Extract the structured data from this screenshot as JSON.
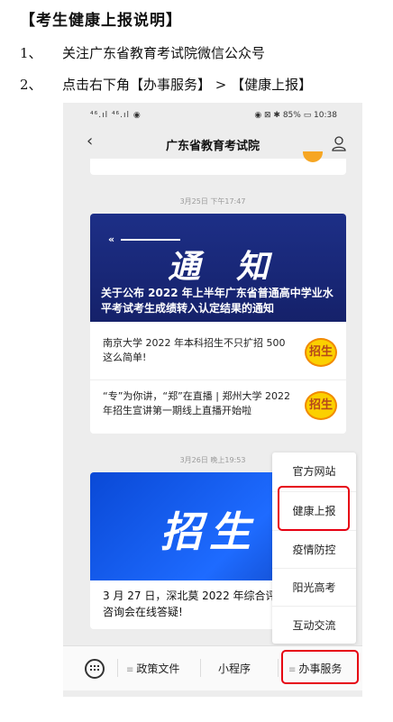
{
  "instructions": {
    "title": "【考生健康上报说明】",
    "steps": [
      {
        "num": "1、",
        "text": "关注广东省教育考试院微信公众号"
      },
      {
        "num": "2、",
        "text": "点击右下角【办事服务】 > 【健康上报】"
      }
    ]
  },
  "statusbar": {
    "left": "⁴⁶.ıl ⁴⁶.ıl ◉",
    "right": "◉ ⊠ ✱ 85% ▭ 10:38"
  },
  "nav": {
    "back_glyph": "‹",
    "title": "广东省教育考试院"
  },
  "feed": {
    "timestamp1": "3月25日 下午17:47",
    "banner1_word": "通知",
    "banner1_deco": "«",
    "banner1_caption": "关于公布 2022 年上半年广东省普通高中学业水平考试考生成绩转入认定结果的通知",
    "articles": [
      {
        "text": "南京大学 2022 年本科招生不只扩招 500 这么简单!",
        "badge": "招生"
      },
      {
        "text": "“专”为你讲，“郑”在直播 | 郑州大学 2022 年招生宣讲第一期线上直播开始啦",
        "badge": "招生"
      }
    ],
    "timestamp2": "3月26日 晚上19:53",
    "banner2_word": "招生",
    "card2_text": "3 月 27 日，深北莫 2022 年综合评价网络直播咨询会在线答疑!"
  },
  "menu": {
    "items": [
      "官方网站",
      "健康上报",
      "疫情防控",
      "阳光高考",
      "互动交流"
    ]
  },
  "tabbar": {
    "tabs": [
      {
        "label": "政策文件",
        "prefix": "≡"
      },
      {
        "label": "小程序",
        "prefix": ""
      },
      {
        "label": "办事服务",
        "prefix": "≡"
      }
    ]
  },
  "colors": {
    "highlight": "#e60012",
    "banner1": "#1d2f87",
    "banner2": "#1e6bff",
    "badge": "#fbd000"
  }
}
